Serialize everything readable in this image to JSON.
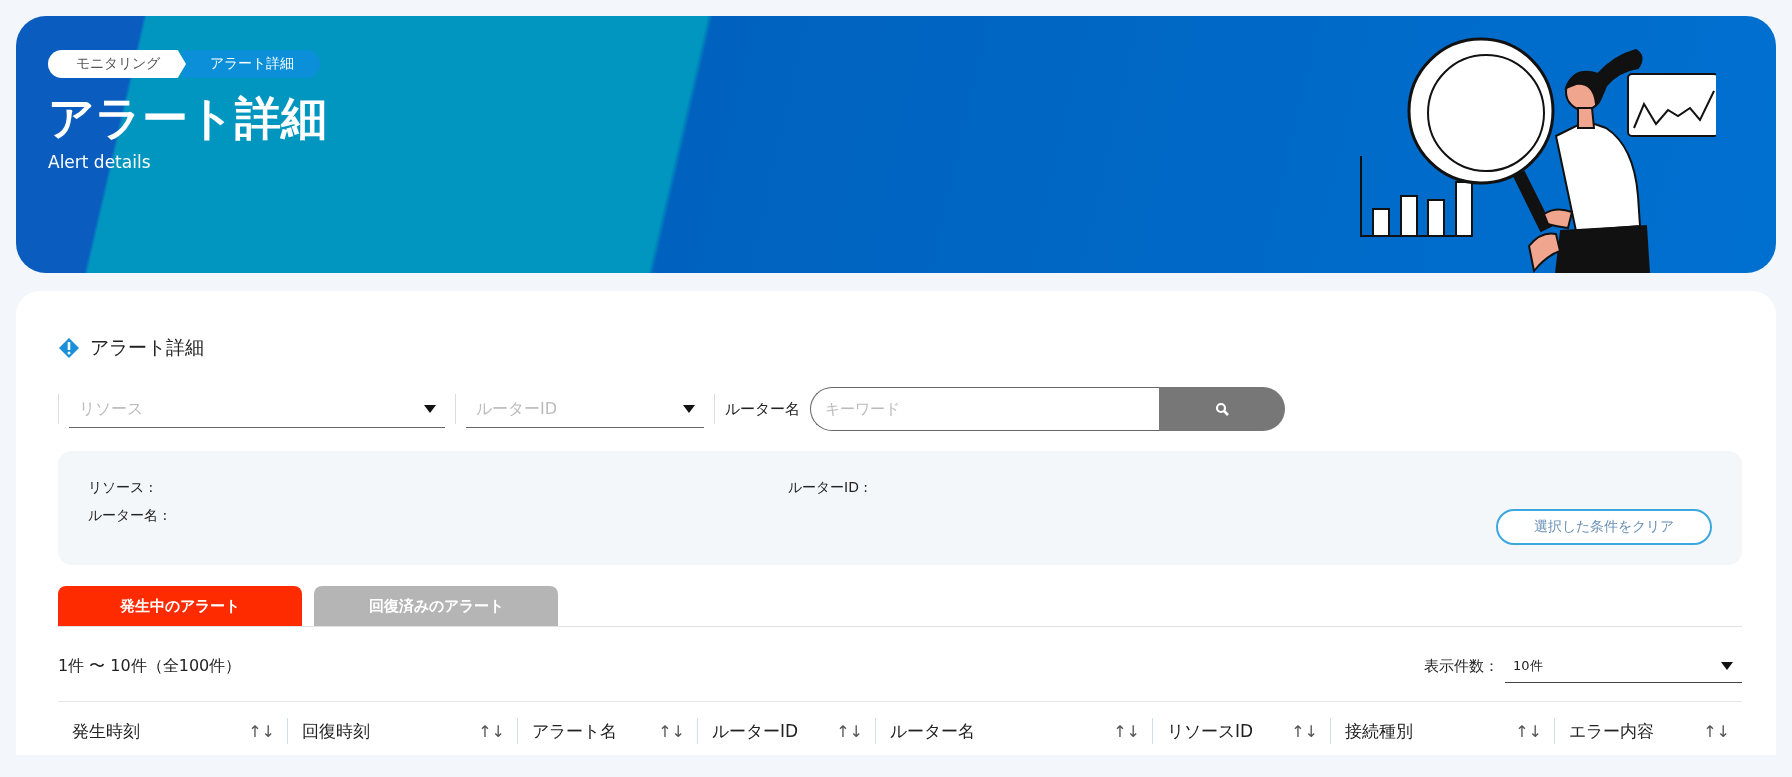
{
  "header": {
    "breadcrumbs": [
      {
        "label": "モニタリング",
        "selected": false
      },
      {
        "label": "アラート詳細",
        "selected": true
      }
    ],
    "title": "アラート詳細",
    "subtitle": "Alert details"
  },
  "section": {
    "title": "アラート詳細"
  },
  "filters": {
    "resource": {
      "placeholder": "リソース"
    },
    "router_id": {
      "placeholder": "ルーターID"
    },
    "router_name_label": "ルーター名",
    "search": {
      "placeholder": "キーワード"
    }
  },
  "criteria": {
    "items": [
      {
        "label": "リソース :"
      },
      {
        "label": "ルーターID :"
      },
      {
        "label": "ルーター名 :"
      }
    ],
    "clear_button": "選択した条件をクリア"
  },
  "tabs": [
    {
      "label": "発生中のアラート",
      "selected": true
    },
    {
      "label": "回復済みのアラート",
      "selected": false
    }
  ],
  "result_count": "1件 〜 10件（全100件）",
  "page_size": {
    "label": "表示件数：",
    "value": "10件"
  },
  "table": {
    "columns": [
      {
        "label": "発生時刻",
        "sort": "↑↓"
      },
      {
        "label": "回復時刻",
        "sort": "↑↓"
      },
      {
        "label": "アラート名",
        "sort": "↑↓"
      },
      {
        "label": "ルーターID",
        "sort": "↑↓"
      },
      {
        "label": "ルーター名",
        "sort": "↑↓"
      },
      {
        "label": "リソースID",
        "sort": "↑↓"
      },
      {
        "label": "接続種別",
        "sort": "↑↓"
      },
      {
        "label": "エラー内容",
        "sort": "↑↓"
      }
    ]
  }
}
